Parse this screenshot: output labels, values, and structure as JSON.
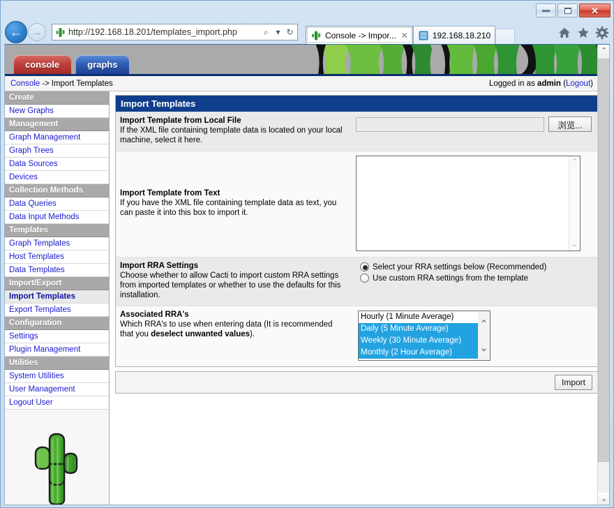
{
  "browser": {
    "window_buttons": {
      "minimize": "Minimize",
      "maximize": "Maximize",
      "close": "✕"
    },
    "back_glyph": "←",
    "forward_glyph": "→",
    "address": "http://192.168.18.201/templates_import.php",
    "address_search_glyph": "⌕",
    "address_dropdown_glyph": "▾",
    "address_refresh_glyph": "↻",
    "tabs": [
      {
        "title": "Console -> Impor...",
        "close_label": "✕",
        "active": true
      },
      {
        "title": "192.168.18.210",
        "active": false
      }
    ],
    "toolbar_icons": [
      "home-icon",
      "favorites-icon",
      "tools-icon"
    ]
  },
  "app": {
    "tabs": [
      {
        "label": "console",
        "active": true
      },
      {
        "label": "graphs",
        "active": false
      }
    ],
    "breadcrumb": {
      "root": "Console",
      "separator": "->",
      "current": "Import Templates"
    },
    "session": {
      "prefix": "Logged in as",
      "user": "admin",
      "logout_open": "(",
      "logout": "Logout",
      "logout_close": ")"
    }
  },
  "sidebar": [
    {
      "type": "header",
      "label": "Create"
    },
    {
      "type": "item",
      "label": "New Graphs",
      "active": false
    },
    {
      "type": "header",
      "label": "Management"
    },
    {
      "type": "item",
      "label": "Graph Management",
      "active": false
    },
    {
      "type": "item",
      "label": "Graph Trees",
      "active": false
    },
    {
      "type": "item",
      "label": "Data Sources",
      "active": false
    },
    {
      "type": "item",
      "label": "Devices",
      "active": false
    },
    {
      "type": "header",
      "label": "Collection Methods"
    },
    {
      "type": "item",
      "label": "Data Queries",
      "active": false
    },
    {
      "type": "item",
      "label": "Data Input Methods",
      "active": false
    },
    {
      "type": "header",
      "label": "Templates"
    },
    {
      "type": "item",
      "label": "Graph Templates",
      "active": false
    },
    {
      "type": "item",
      "label": "Host Templates",
      "active": false
    },
    {
      "type": "item",
      "label": "Data Templates",
      "active": false
    },
    {
      "type": "header",
      "label": "Import/Export"
    },
    {
      "type": "item",
      "label": "Import Templates",
      "active": true
    },
    {
      "type": "item",
      "label": "Export Templates",
      "active": false
    },
    {
      "type": "header",
      "label": "Configuration"
    },
    {
      "type": "item",
      "label": "Settings",
      "active": false
    },
    {
      "type": "item",
      "label": "Plugin Management",
      "active": false
    },
    {
      "type": "header",
      "label": "Utilities"
    },
    {
      "type": "item",
      "label": "System Utilities",
      "active": false
    },
    {
      "type": "item",
      "label": "User Management",
      "active": false
    },
    {
      "type": "item",
      "label": "Logout User",
      "active": false
    }
  ],
  "panel": {
    "title": "Import Templates",
    "rows": {
      "local_file": {
        "title": "Import Template from Local File",
        "desc": "If the XML file containing template data is located on your local machine, select it here.",
        "file_value": "",
        "browse_label": "浏览..."
      },
      "from_text": {
        "title": "Import Template from Text",
        "desc": "If you have the XML file containing template data as text, you can paste it into this box to import it.",
        "textarea_value": "",
        "scroll_up_glyph": "⌃",
        "scroll_down_glyph": "⌄"
      },
      "rra_settings": {
        "title": "Import RRA Settings",
        "desc": "Choose whether to allow Cacti to import custom RRA settings from imported templates or whether to use the defaults for this installation.",
        "options": [
          {
            "label": "Select your RRA settings below (Recommended)",
            "selected": true
          },
          {
            "label": "Use custom RRA settings from the template",
            "selected": false
          }
        ]
      },
      "associated_rras": {
        "title": "Associated RRA's",
        "desc_before": "Which RRA's to use when entering data (It is recommended that you ",
        "desc_bold": "deselect unwanted values",
        "desc_after": ").",
        "options": [
          {
            "label": "Hourly (1 Minute Average)",
            "selected": false
          },
          {
            "label": "Daily (5 Minute Average)",
            "selected": true
          },
          {
            "label": "Weekly (30 Minute Average)",
            "selected": true
          },
          {
            "label": "Monthly (2 Hour Average)",
            "selected": true
          }
        ],
        "scroll_up_glyph": "⌃",
        "scroll_down_glyph": "⌄"
      }
    },
    "submit_label": "Import"
  },
  "page_scrollbar": {
    "up_glyph": "⌃",
    "down_glyph": "⌄"
  },
  "colors": {
    "panel_title_bg": "#0f3e8c",
    "link": "#1a1ad0",
    "selection": "#22a2e0",
    "sidebar_header_bg": "#a9a9a9",
    "console_tab": "#c2413c",
    "graphs_tab": "#2f60b8"
  }
}
